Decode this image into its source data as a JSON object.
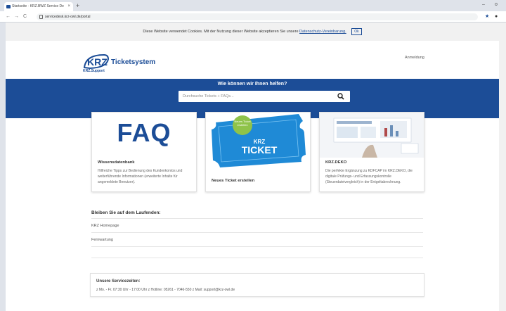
{
  "browser": {
    "tab_title": "Startseite · KRZ.BWZ Service De",
    "new_tab": "+",
    "url": "servicedesk.krz-owl.de/portal",
    "minimize": "–",
    "window_icon": "o",
    "extension_icon": "star-icon",
    "profile_icon": "user-icon"
  },
  "cookie": {
    "text": "Diese Website verwendet Cookies. Mit der Nutzung dieser Website akzeptieren Sie unsere",
    "link": "Datenschutz-Vereinbarung.",
    "ok": "Ok"
  },
  "header": {
    "login": "Anmeldung",
    "logo_mark": "KRZ",
    "logo_title": "Ticketsystem",
    "logo_sub": "KRZ.Support"
  },
  "hero": {
    "title": "Wie können wir Ihnen helfen?",
    "search_placeholder": "Durchsuche Tickets + FAQs..."
  },
  "cards": [
    {
      "media_word": "FAQ",
      "title": "Wissensdatenbank",
      "text": "Hilfreiche Tipps zur Bedienung des Kundenkontos und weiterführende Informationen (erweiterte Inhalte für angemeldete Benutzer)."
    },
    {
      "badge": "Neues Ticket erstellen",
      "ticket_brand": "KRZ",
      "ticket_word": "TICKET",
      "title": "Neues Ticket erstellen"
    },
    {
      "title": "KRZ.DEKO",
      "text": "Die perfekte Ergänzung zu KDFCAP im KRZ.DEKO, die digitale Prüfungs- und Erfassungskontrolle (Steuerdateivergleich) in der Entgeltabrechnung."
    }
  ],
  "updates": {
    "title": "Bleiben Sie auf dem Laufenden:",
    "links": [
      "KRZ Homepage",
      "Fernwartung"
    ]
  },
  "service": {
    "title": "Unsere Servicezeiten:",
    "text": "z Mo. - Fr. 07:30 Uhr - 17:00 Uhr z Hotline: 05261 - 7046-550 z Mail: support@krz-owl.de"
  },
  "colors": {
    "brand": "#1c4d97",
    "badge": "#8fc34a",
    "ticket": "#1f8ad6"
  }
}
